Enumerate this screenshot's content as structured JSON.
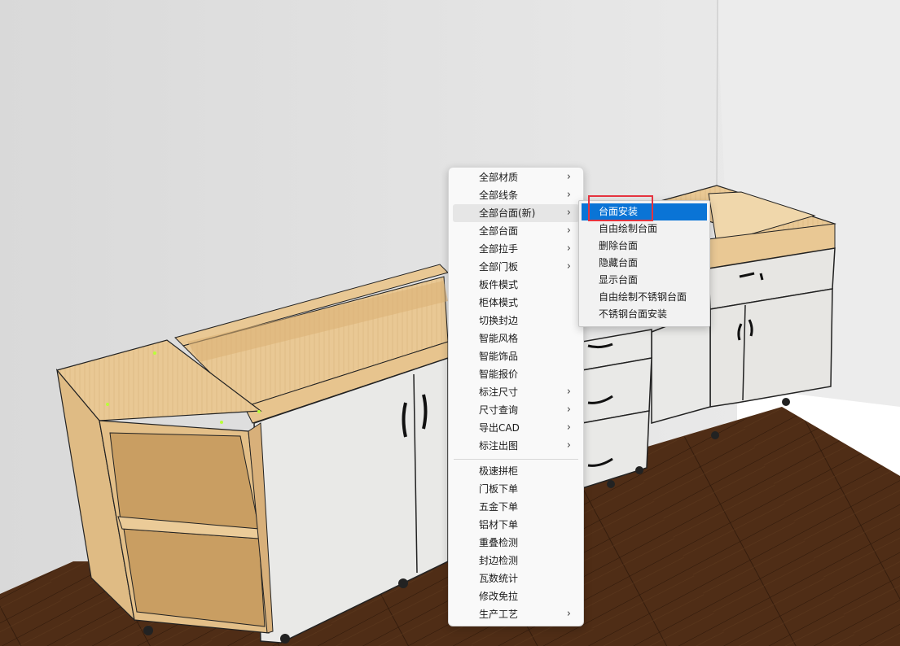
{
  "colors": {
    "wall": "#e4e4e4",
    "floor": "#4a2a14",
    "wood": "#e6c48f",
    "door": "#e9e9e7",
    "menu_bg": "#f9f9f9",
    "highlight": "#0a74d6",
    "annotation": "#e5333f"
  },
  "context_menu": {
    "items": [
      {
        "label": "全部材质",
        "submenu": true
      },
      {
        "label": "全部线条",
        "submenu": true
      },
      {
        "label": "全部台面(新)",
        "submenu": true,
        "hover": true
      },
      {
        "label": "全部台面",
        "submenu": true
      },
      {
        "label": "全部拉手",
        "submenu": true
      },
      {
        "label": "全部门板",
        "submenu": true
      },
      {
        "label": "板件模式",
        "submenu": false
      },
      {
        "label": "柜体模式",
        "submenu": false
      },
      {
        "label": "切换封边",
        "submenu": false
      },
      {
        "label": "智能风格",
        "submenu": false
      },
      {
        "label": "智能饰品",
        "submenu": false
      },
      {
        "label": "智能报价",
        "submenu": false
      },
      {
        "label": "标注尺寸",
        "submenu": true
      },
      {
        "label": "尺寸查询",
        "submenu": true
      },
      {
        "label": "导出CAD",
        "submenu": true
      },
      {
        "label": "标注出图",
        "submenu": true
      }
    ],
    "items2": [
      {
        "label": "极速拼柜",
        "submenu": false
      },
      {
        "label": "门板下单",
        "submenu": false
      },
      {
        "label": "五金下单",
        "submenu": false
      },
      {
        "label": "铝材下单",
        "submenu": false
      },
      {
        "label": "重叠检测",
        "submenu": false
      },
      {
        "label": "封边检测",
        "submenu": false
      },
      {
        "label": "瓦数统计",
        "submenu": false
      },
      {
        "label": "修改免拉",
        "submenu": false
      },
      {
        "label": "生产工艺",
        "submenu": true
      }
    ]
  },
  "submenu": {
    "items": [
      {
        "label": "台面安装",
        "selected": true
      },
      {
        "label": "自由绘制台面",
        "selected": false
      },
      {
        "label": "删除台面",
        "selected": false
      },
      {
        "label": "隐藏台面",
        "selected": false
      },
      {
        "label": "显示台面",
        "selected": false
      },
      {
        "label": "自由绘制不锈钢台面",
        "selected": false
      },
      {
        "label": "不锈钢台面安装",
        "selected": false
      }
    ]
  }
}
